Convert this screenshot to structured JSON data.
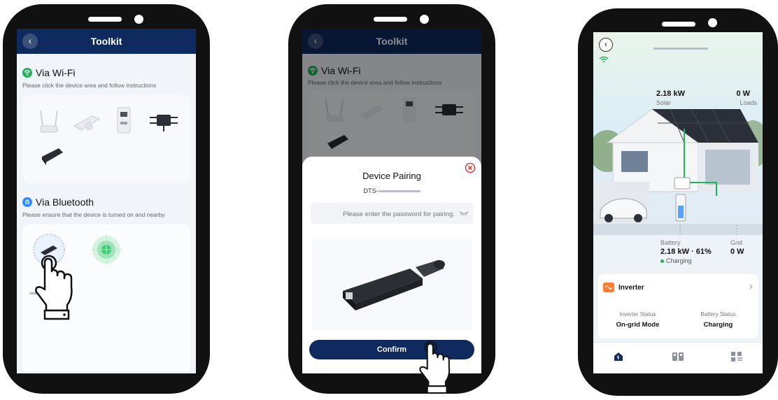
{
  "phone1": {
    "header_title": "Toolkit",
    "wifi_title": "Via Wi-Fi",
    "wifi_subtitle": "Please click the device area and follow instructions",
    "bt_title": "Via Bluetooth",
    "bt_subtitle": "Please ensure that the device is turned on and nearby",
    "icons": [
      "back-icon",
      "wifi-icon",
      "bluetooth-icon",
      "router-icon",
      "wifi-stick-icon",
      "meter-icon",
      "microinverter-icon",
      "dongle-icon",
      "radar-icon",
      "tap-hand-icon"
    ]
  },
  "phone2": {
    "header_title": "Toolkit",
    "wifi_title": "Via Wi-Fi",
    "wifi_subtitle": "Please click the device area and follow instructions",
    "dialog_title": "Device Pairing",
    "device_id_prefix": "DTS-",
    "password_placeholder": "Please enter the password for pairing.",
    "confirm_label": "Confirm",
    "icons": [
      "close-icon",
      "eye-hidden-icon",
      "dongle-photo",
      "tap-hand-icon"
    ]
  },
  "phone3": {
    "solar_value": "2.18 kW",
    "solar_label": "Solar",
    "loads_value": "0 W",
    "loads_label": "Loads",
    "battery_label": "Battery",
    "battery_value": "2.18 kW · 61%",
    "battery_status": "Charging",
    "grid_label": "Grid",
    "grid_value": "0 W",
    "inverter_title": "Inverter",
    "inverter_status_label": "Inverter Status",
    "inverter_status_value": "On-grid Mode",
    "battery_status_label": "Battery Status",
    "battery_status_value": "Charging",
    "nav_items": [
      "home-icon",
      "devices-icon",
      "menu-icon"
    ],
    "colors": {
      "accent_navy": "#0e2a5e",
      "charging_green": "#1fb35a",
      "inverter_orange": "#ff7a2d"
    }
  }
}
